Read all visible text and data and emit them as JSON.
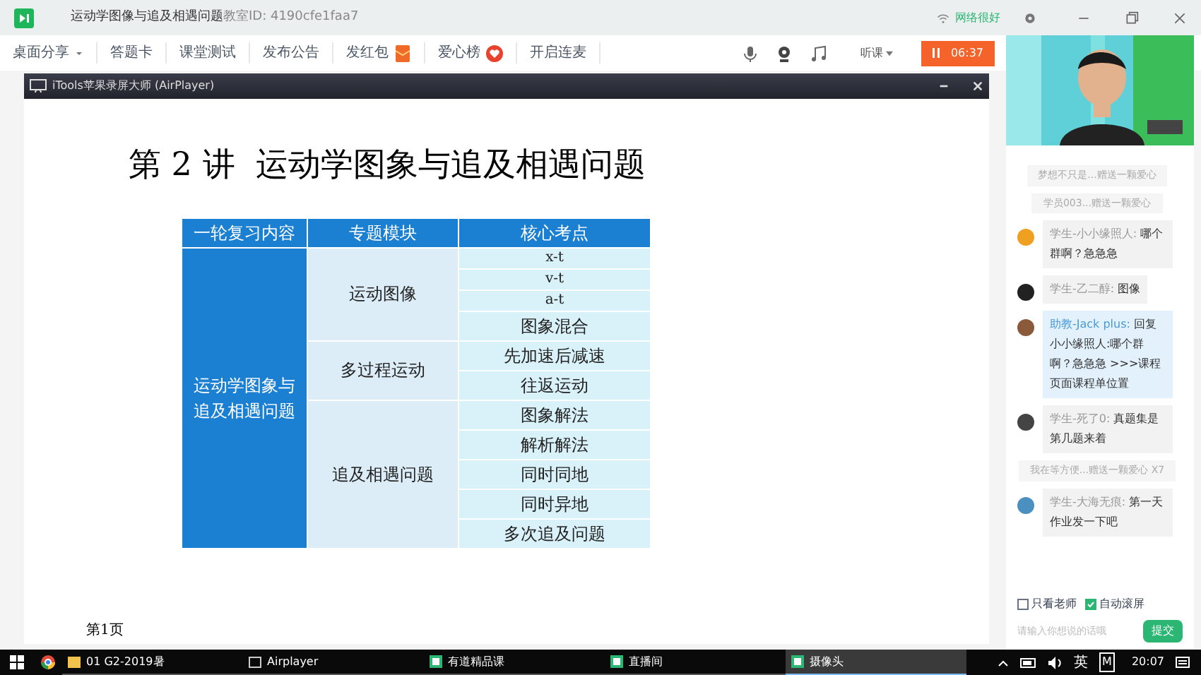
{
  "window": {
    "title": "运动学图像与追及相遇问题",
    "classroom_id": "教室ID: 4190cfe1faa7",
    "network": "网络很好"
  },
  "toolbar": {
    "items": [
      {
        "label": "桌面分享",
        "kind": "dropdown"
      },
      {
        "label": "答题卡",
        "kind": "plain"
      },
      {
        "label": "课堂测试",
        "kind": "plain"
      },
      {
        "label": "发布公告",
        "kind": "plain"
      },
      {
        "label": "发红包",
        "kind": "redpacket"
      },
      {
        "label": "爱心榜",
        "kind": "heart"
      },
      {
        "label": "开启连麦",
        "kind": "plain"
      }
    ],
    "listen": "听课",
    "timer": "06:37"
  },
  "player": {
    "title": "iTools苹果录屏大师 (AirPlayer)",
    "slide": {
      "heading": "第 2 讲  运动学图象与追及相遇问题",
      "page": "第1页",
      "table": {
        "columns": [
          "一轮复习内容",
          "专题模块",
          "核心考点"
        ],
        "rows": [
          {
            "topic": "运动学图象与追及相遇问题",
            "modules": [
              {
                "name": "运动图像",
                "points": [
                  {
                    "text": "x-t",
                    "kind": "formula"
                  },
                  {
                    "text": "v-t",
                    "kind": "formula"
                  },
                  {
                    "text": "a-t",
                    "kind": "formula"
                  },
                  {
                    "text": "图象混合",
                    "kind": "text"
                  }
                ]
              },
              {
                "name": "多过程运动",
                "points": [
                  {
                    "text": "先加速后减速",
                    "kind": "text"
                  },
                  {
                    "text": "往返运动",
                    "kind": "text"
                  }
                ]
              },
              {
                "name": "追及相遇问题",
                "points": [
                  {
                    "text": "图象解法",
                    "kind": "text"
                  },
                  {
                    "text": "解析解法",
                    "kind": "text"
                  },
                  {
                    "text": "同时同地",
                    "kind": "text"
                  },
                  {
                    "text": "同时异地",
                    "kind": "text"
                  },
                  {
                    "text": "多次追及问题",
                    "kind": "text"
                  }
                ]
              }
            ]
          }
        ]
      }
    }
  },
  "chat": {
    "messages": [
      {
        "kind": "system",
        "text": "梦想不只是...赠送一颗爱心"
      },
      {
        "kind": "system",
        "text": "学员003...赠送一颗爱心"
      },
      {
        "kind": "student",
        "color": "#f0a020",
        "name": "学生-小小缘照人:",
        "text": "哪个群啊？急急急"
      },
      {
        "kind": "student",
        "color": "#222222",
        "name": "学生-乙二醇:",
        "text": "图像"
      },
      {
        "kind": "assistant",
        "color": "#8a5a3a",
        "name": "助教-Jack plus:",
        "text": "回复小小缘照人:哪个群啊？急急急 >>>课程页面课程单位置"
      },
      {
        "kind": "student",
        "color": "#444444",
        "name": "学生-死了0:",
        "text": "真题集是第几题来着"
      },
      {
        "kind": "system",
        "text": "我在等方便...赠送一颗爱心 X7"
      },
      {
        "kind": "student",
        "color": "#4a90c0",
        "name": "学生-大海无痕:",
        "text": "第一天作业发一下吧"
      }
    ],
    "only_teacher": {
      "label": "只看老师",
      "checked": false
    },
    "auto_scroll": {
      "label": "自动滚屏",
      "checked": true
    },
    "input": {
      "placeholder": "请输入你想说的话哦"
    },
    "send": "提交"
  },
  "taskbar": {
    "items": [
      {
        "label": "01 G2-2019暑",
        "kind": "folder",
        "selected": false
      },
      {
        "label": "Airplayer",
        "kind": "window",
        "selected": false
      },
      {
        "label": "有道精品课",
        "kind": "app",
        "selected": false
      },
      {
        "label": "直播间",
        "kind": "app",
        "selected": false
      },
      {
        "label": "摄像头",
        "kind": "app",
        "selected": true
      }
    ],
    "ime": "英",
    "ime_mode": "M",
    "clock": "20:07"
  }
}
